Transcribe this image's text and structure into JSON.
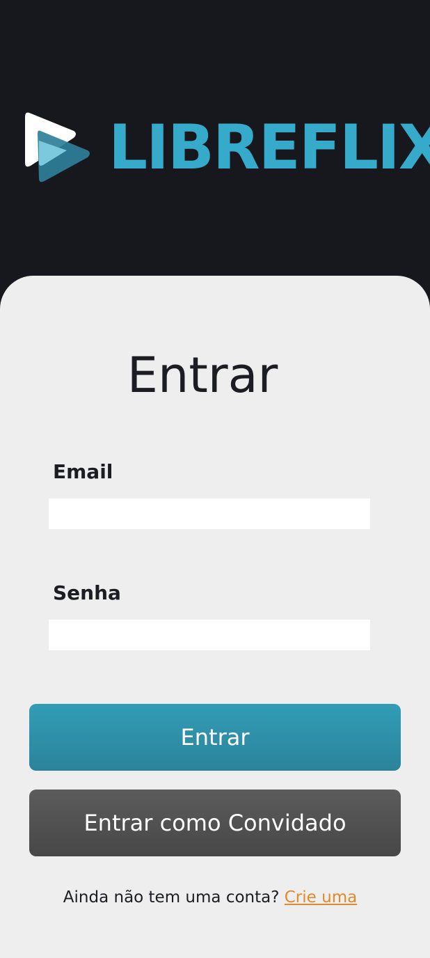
{
  "brand": {
    "name": "LIBREFLIX",
    "color": "#35aacb",
    "logo_icon": "play-triangle-icon"
  },
  "login": {
    "title": "Entrar",
    "email_label": "Email",
    "email_value": "",
    "password_label": "Senha",
    "password_value": "",
    "submit_label": "Entrar",
    "guest_label": "Entrar como Convidado",
    "signup_prompt": "Ainda não tem uma conta?",
    "signup_link": "Crie uma"
  },
  "colors": {
    "background": "#16181d",
    "card": "#eeeeee",
    "primary_button": "#2f93ab",
    "guest_button": "#535353",
    "link": "#e08a2c"
  }
}
